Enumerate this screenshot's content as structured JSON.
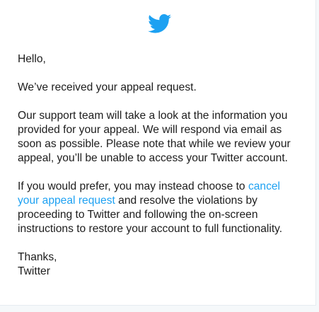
{
  "email": {
    "logo_icon": "twitter-bird-icon",
    "brand_color": "#1da1f2",
    "greeting": "Hello,",
    "received": "We’ve received your appeal request.",
    "support_paragraph": "Our support team will take a look at the information you provided for your appeal. We will respond via email as soon as possible. Please note that while we review your appeal, you’ll be unable to access your Twitter account.",
    "prefer_before": "If you would prefer, you may instead choose to ",
    "cancel_link": "cancel your appeal request",
    "prefer_after": " and resolve the violations by proceeding to Twitter and following the on-screen instructions to restore your account to full functionality.",
    "closing": "Thanks,",
    "signature": "Twitter"
  }
}
